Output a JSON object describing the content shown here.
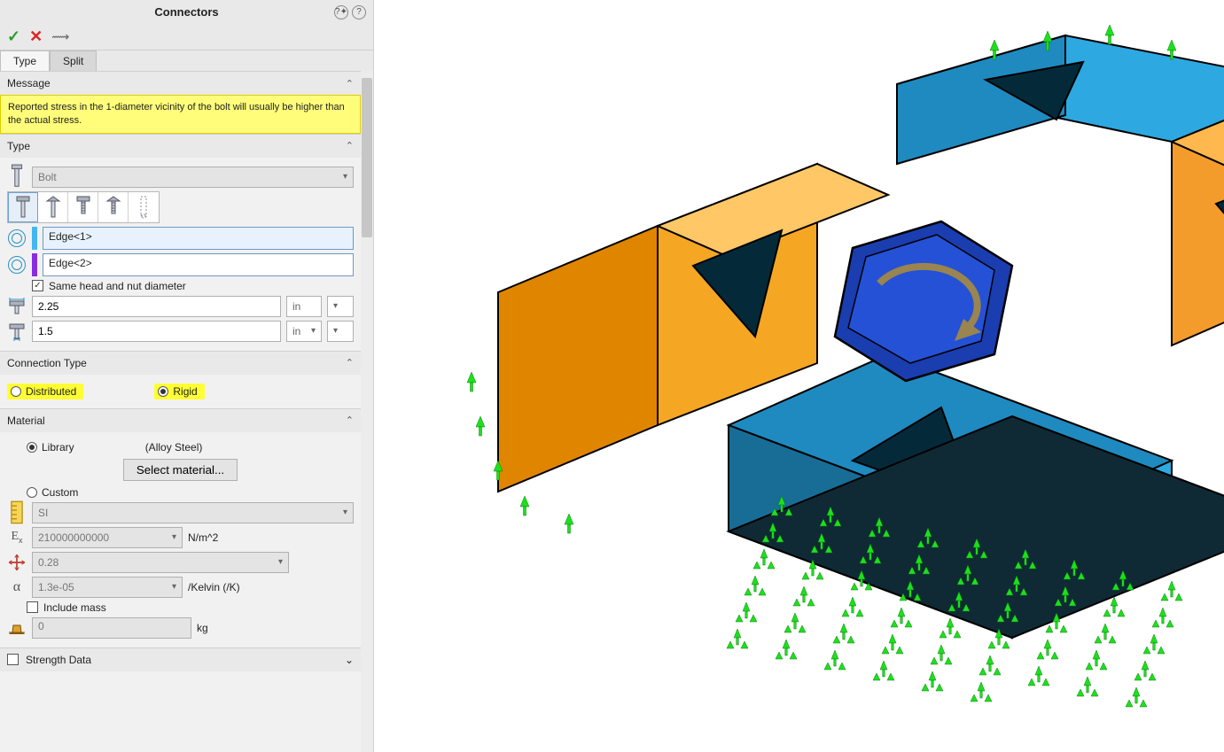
{
  "panel": {
    "title": "Connectors",
    "tabs": {
      "type": "Type",
      "split": "Split"
    }
  },
  "message": {
    "header": "Message",
    "body": "Reported stress in the 1-diameter vicinity of the bolt will usually be higher than the actual stress."
  },
  "type": {
    "header": "Type",
    "connector_type": "Bolt",
    "edge1": "Edge<1>",
    "edge2": "Edge<2>",
    "same_diam_label": "Same head and nut diameter",
    "head_diam": "2.25",
    "shank_diam": "1.5",
    "unit": "in"
  },
  "connection_type": {
    "header": "Connection Type",
    "distributed": "Distributed",
    "rigid": "Rigid"
  },
  "material": {
    "header": "Material",
    "library_label": "Library",
    "library_name": "(Alloy Steel)",
    "select_btn": "Select material...",
    "custom_label": "Custom",
    "unit_system": "SI",
    "E_label": "Ex",
    "E_val": "210000000000",
    "E_unit": "N/m^2",
    "nu_val": "0.28",
    "alpha_label": "α",
    "alpha_val": "1.3e-05",
    "alpha_unit": "/Kelvin (/K)",
    "include_mass_label": "Include mass",
    "mass_val": "0",
    "mass_unit": "kg"
  },
  "strength": {
    "header": "Strength Data"
  }
}
